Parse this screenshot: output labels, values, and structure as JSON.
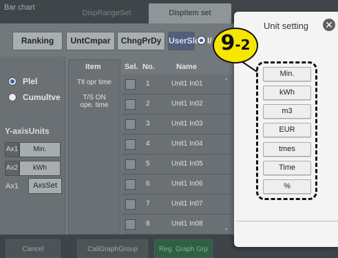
{
  "tabs": [
    "Bar chart",
    "DispRangeSet",
    "DispItem set"
  ],
  "toolbar": {
    "buttons": [
      "Ranking",
      "UntCmpar",
      "ChngPrDy",
      "UserSlct"
    ],
    "radio_label": "I/"
  },
  "left_panel": {
    "radios": [
      "Plel",
      "Cumultve"
    ],
    "y_axis_units_label": "Y-axisUnits",
    "axes": [
      {
        "label": "Ax1",
        "value": "Min."
      },
      {
        "label": "Ax2",
        "value": "kWh"
      }
    ],
    "axset_label": "Ax1",
    "axset_button": "AxsSet"
  },
  "table": {
    "headers": {
      "item": "Item",
      "sel": "Sel.",
      "no": "No.",
      "name": "Name"
    },
    "item_texts": [
      "Ttl opr time",
      "T/S ON\nope. time"
    ],
    "rows": [
      {
        "no": "1",
        "name": "Unit1 In01"
      },
      {
        "no": "2",
        "name": "Unit1 In02"
      },
      {
        "no": "3",
        "name": "Unit1 In03"
      },
      {
        "no": "4",
        "name": "Unit1 In04"
      },
      {
        "no": "5",
        "name": "Unit1 In05"
      },
      {
        "no": "6",
        "name": "Unit1 In06"
      },
      {
        "no": "7",
        "name": "Unit1 In07"
      },
      {
        "no": "8",
        "name": "Unit1 In08"
      }
    ]
  },
  "bottom": {
    "cancel": "Cancel",
    "call_graph_group": "CallGraphGroup",
    "reg_graph_grp": "Reg. Graph Grp"
  },
  "popup": {
    "title": "Unit setting",
    "units": [
      "Min.",
      "kWh",
      "m3",
      "EUR",
      "tmes",
      "Time",
      "%"
    ]
  },
  "badge": {
    "main": "9",
    "sub": "-2"
  },
  "colors": {
    "badge": "#f6e600",
    "active_button": "#515e7c",
    "green_button": "#2f6046"
  }
}
